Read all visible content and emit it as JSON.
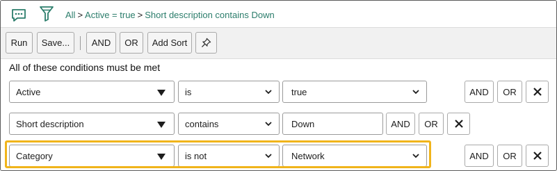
{
  "breadcrumb": {
    "items": [
      "All",
      "Active = true",
      "Short description contains Down"
    ],
    "separator": ">"
  },
  "toolbar": {
    "run_label": "Run",
    "save_label": "Save...",
    "and_label": "AND",
    "or_label": "OR",
    "add_sort_label": "Add Sort"
  },
  "conditions": {
    "heading": "All of these conditions must be met",
    "rows": [
      {
        "field": "Active",
        "operator": "is",
        "value": "true",
        "and_label": "AND",
        "or_label": "OR"
      },
      {
        "field": "Short description",
        "operator": "contains",
        "value": "Down",
        "and_label": "AND",
        "or_label": "OR"
      },
      {
        "field": "Category",
        "operator": "is not",
        "value": "Network",
        "and_label": "AND",
        "or_label": "OR"
      }
    ]
  },
  "colors": {
    "accent": "#2b7d6b",
    "highlight": "#f0b41b"
  },
  "icons": [
    "chat-icon",
    "filter-icon",
    "pin-icon",
    "chevron-down-icon",
    "close-icon"
  ]
}
